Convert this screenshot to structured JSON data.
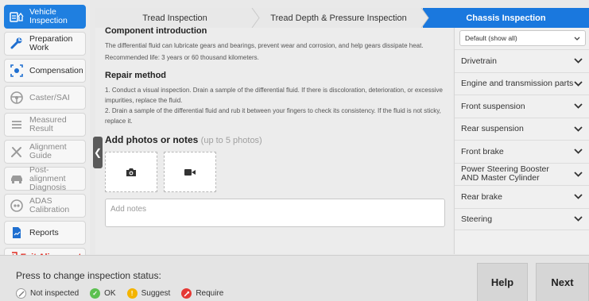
{
  "sidebar": {
    "items": [
      {
        "label": "Vehicle Inspection",
        "icon": "vehicle-inspection-icon"
      },
      {
        "label": "Preparation Work",
        "icon": "wrench-icon"
      },
      {
        "label": "Compensation",
        "icon": "compensation-icon"
      },
      {
        "label": "Caster/SAI",
        "icon": "steering-wheel-icon"
      },
      {
        "label": "Measured Result",
        "icon": "list-icon"
      },
      {
        "label": "Alignment Guide",
        "icon": "tools-icon"
      },
      {
        "label": "Post-alignment Diagnosis",
        "icon": "car-icon"
      },
      {
        "label": "ADAS Calibration",
        "icon": "adas-icon"
      },
      {
        "label": "Reports",
        "icon": "report-icon"
      }
    ],
    "exit_label": "Exit Alignment"
  },
  "tabs": [
    {
      "label": "Tread Inspection"
    },
    {
      "label": "Tread Depth & Pressure Inspection"
    },
    {
      "label": "Chassis Inspection"
    }
  ],
  "content": {
    "component_title": "Component introduction",
    "component_text": "The differential fluid can lubricate gears and bearings, prevent wear and corrosion, and help gears dissipate heat.",
    "recommended_life": "Recommended life: 3 years or 60 thousand kilometers.",
    "repair_title": "Repair method",
    "repair_step1": "1. Conduct a visual inspection. Drain a sample of the differential fluid. If there is discoloration, deterioration, or excessive impurities, replace the fluid.",
    "repair_step2": "2. Drain a sample of the differential fluid and rub it between your fingers to check its consistency. If the fluid is not sticky, replace it.",
    "photos_title": "Add photos or notes",
    "photos_hint": "(up to 5 photos)",
    "notes_placeholder": "Add notes"
  },
  "right_panel": {
    "filter_value": "Default (show all)",
    "items": [
      {
        "label": "Drivetrain"
      },
      {
        "label": "Engine and transmission parts"
      },
      {
        "label": "Front suspension"
      },
      {
        "label": "Rear suspension"
      },
      {
        "label": "Front brake"
      },
      {
        "label": "Power Steering Booster AND Master Cylinder"
      },
      {
        "label": "Rear brake"
      },
      {
        "label": "Steering"
      }
    ]
  },
  "footer": {
    "title": "Press to change inspection status:",
    "statuses": [
      {
        "label": "Not inspected",
        "color": "#9a9a9a"
      },
      {
        "label": "OK",
        "color": "#5cc050"
      },
      {
        "label": "Suggest",
        "color": "#f4b400"
      },
      {
        "label": "Require",
        "color": "#e53935"
      }
    ],
    "help_label": "Help",
    "next_label": "Next"
  },
  "colors": {
    "accent": "#1a78de",
    "exit": "#e0281e"
  }
}
